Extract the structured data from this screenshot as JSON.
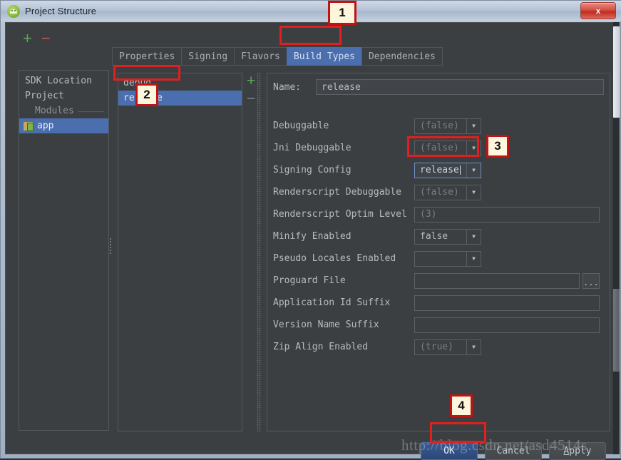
{
  "window": {
    "title": "Project Structure",
    "icon": "android-studio-icon",
    "close_label": "x"
  },
  "toolbar": {
    "add_label": "+",
    "remove_label": "−"
  },
  "tabs": [
    {
      "label": "Properties",
      "selected": false
    },
    {
      "label": "Signing",
      "selected": false
    },
    {
      "label": "Flavors",
      "selected": false
    },
    {
      "label": "Build Types",
      "selected": true
    },
    {
      "label": "Dependencies",
      "selected": false
    }
  ],
  "sidebar": {
    "items": [
      {
        "label": "SDK Location",
        "type": "item",
        "selected": false
      },
      {
        "label": "Project",
        "type": "item",
        "selected": false
      },
      {
        "label": "Modules",
        "type": "group",
        "selected": false
      },
      {
        "label": "app",
        "type": "module",
        "selected": true
      }
    ]
  },
  "build_types": {
    "items": [
      {
        "label": "debug",
        "selected": false
      },
      {
        "label": "release",
        "selected": true
      }
    ],
    "add_label": "+",
    "remove_label": "−"
  },
  "detail": {
    "name_label": "Name:",
    "name_value": "release",
    "rows": [
      {
        "label": "Debuggable",
        "control": "combo",
        "value": "(false)",
        "muted": true,
        "focused": false
      },
      {
        "label": "Jni Debuggable",
        "control": "combo",
        "value": "(false)",
        "muted": true,
        "focused": false
      },
      {
        "label": "Signing Config",
        "control": "combo",
        "value": "release",
        "muted": false,
        "focused": true
      },
      {
        "label": "Renderscript Debuggable",
        "control": "combo",
        "value": "(false)",
        "muted": true,
        "focused": false
      },
      {
        "label": "Renderscript Optim Level",
        "control": "textbox",
        "value": "(3)",
        "muted": true,
        "focused": false
      },
      {
        "label": "Minify Enabled",
        "control": "combo",
        "value": "false",
        "muted": false,
        "focused": false
      },
      {
        "label": "Pseudo Locales Enabled",
        "control": "combo",
        "value": "",
        "muted": true,
        "focused": false
      },
      {
        "label": "Proguard File",
        "control": "browse",
        "value": "",
        "muted": true,
        "focused": false
      },
      {
        "label": "Application Id Suffix",
        "control": "textbox",
        "value": "",
        "muted": true,
        "focused": false
      },
      {
        "label": "Version Name Suffix",
        "control": "textbox",
        "value": "",
        "muted": true,
        "focused": false
      },
      {
        "label": "Zip Align Enabled",
        "control": "combo",
        "value": "(true)",
        "muted": true,
        "focused": false
      }
    ],
    "browse_label": "..."
  },
  "buttons": {
    "ok": "OK",
    "cancel": "Cancel",
    "apply_prefix": "",
    "apply_accel": "A",
    "apply_rest": "pply"
  },
  "annotations": [
    {
      "number": "1",
      "target": "build-types-tab"
    },
    {
      "number": "2",
      "target": "release-build-type"
    },
    {
      "number": "3",
      "target": "signing-config-combo"
    },
    {
      "number": "4",
      "target": "ok-button"
    }
  ],
  "watermark": "http://blog.csdn.net/asd4514s",
  "colors": {
    "panel_bg": "#3c3f41",
    "selection_blue": "#4b6eaf",
    "annotation_red": "#e02020",
    "callout_bg": "#fdf6dd",
    "add_green": "#5aa854",
    "remove_red": "#bf5b52"
  }
}
